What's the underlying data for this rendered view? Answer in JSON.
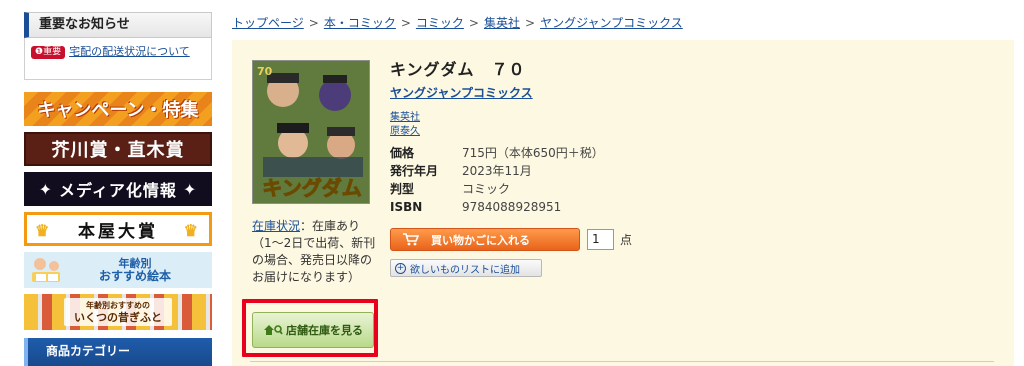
{
  "sidebar": {
    "notice_title": "重要なお知らせ",
    "notice_tag": "❶重要",
    "notice_link": "宅配の配送状況について",
    "banners": {
      "campaign": "キャンペーン・特集",
      "award_akutagawa": "芥川賞・直木賞",
      "media": "メディア化情報",
      "bookstore_award": "本屋大賞",
      "age_line1": "年齢別",
      "age_line2": "おすすめ絵本",
      "story_line1": "年齢別おすすめの",
      "story_line2": "いくつの昔ぎふと"
    },
    "category_title": "商品カテゴリー"
  },
  "breadcrumb": [
    "トップページ",
    "本・コミック",
    "コミック",
    "集英社",
    "ヤングジャンプコミックス"
  ],
  "breadcrumb_sep": ">",
  "product": {
    "cover_text": "キングダム",
    "volume_badge": "70",
    "title": "キングダム　７０",
    "label": "ヤングジャンプコミックス",
    "publisher": "集英社",
    "author": "原泰久",
    "specs": [
      {
        "key": "価格",
        "value": "715円（本体650円＋税）"
      },
      {
        "key": "発行年月",
        "value": "2023年11月"
      },
      {
        "key": "判型",
        "value": "コミック"
      },
      {
        "key": "ISBN",
        "value": "9784088928951"
      }
    ],
    "stock_label": "在庫状況",
    "stock_text": "：在庫あり（1〜2日で出荷、新刊の場合、発売日以降のお届けになります）",
    "cart_button": "買い物かごに入れる",
    "quantity": "1",
    "quantity_unit": "点",
    "wishlist_button": "欲しいものリストに追加",
    "store_stock_button": "店舗在庫を見る"
  },
  "colors": {
    "link": "#1a4f97",
    "panel_bg": "#fdf8e2",
    "cart_orange": "#e8641a",
    "highlight_red": "#e8001c",
    "store_green": "#b9d98a"
  }
}
